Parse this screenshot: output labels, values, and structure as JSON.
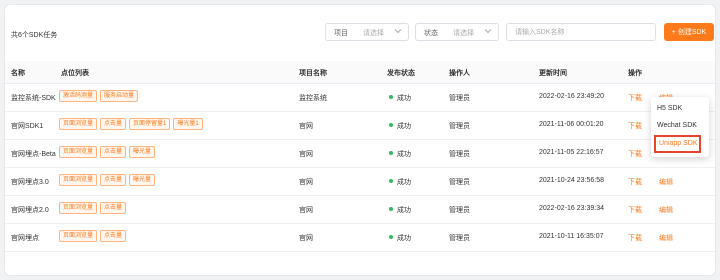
{
  "toolbar": {
    "summary": "共6个SDK任务",
    "project_label": "项目",
    "project_placeholder": "请选择",
    "status_label": "状态",
    "status_placeholder": "请选择",
    "search_placeholder": "请输入SDK名称",
    "create_label": "+ 创建SDK"
  },
  "table": {
    "headers": {
      "name": "名称",
      "points": "点位列表",
      "project": "项目名称",
      "status": "发布状态",
      "operator": "操作人",
      "updated": "更新时间",
      "actions": "操作"
    },
    "rows": [
      {
        "name": "监控系统-SDK",
        "points": [
          "激活码测量",
          "服务启动量"
        ],
        "project": "监控系统",
        "status": "成功",
        "operator": "管理员",
        "updated": "2022-02-16 23:49:20",
        "download": "下载",
        "edit": "编辑"
      },
      {
        "name": "官网SDK1",
        "points": [
          "页面浏览量",
          "点击量",
          "页面停留量1",
          "曝光量1"
        ],
        "project": "官网",
        "status": "成功",
        "operator": "管理员",
        "updated": "2021-11-06 00:01:20",
        "download": "下载",
        "edit": "编辑"
      },
      {
        "name": "官网埋点-Beta",
        "points": [
          "页面浏览量",
          "点击量",
          "曝光量"
        ],
        "project": "官网",
        "status": "成功",
        "operator": "管理员",
        "updated": "2021-11-05 22:16:57",
        "download": "下载",
        "edit": "编辑"
      },
      {
        "name": "官网埋点3.0",
        "points": [
          "页面浏览量",
          "点击量",
          "曝光量"
        ],
        "project": "官网",
        "status": "成功",
        "operator": "管理员",
        "updated": "2021-10-24 23:56:58",
        "download": "下载",
        "edit": "编辑"
      },
      {
        "name": "官网埋点2.0",
        "points": [
          "页面浏览量",
          "点击量"
        ],
        "project": "官网",
        "status": "成功",
        "operator": "管理员",
        "updated": "2022-02-16 23:39:34",
        "download": "下载",
        "edit": "编辑"
      },
      {
        "name": "官网埋点",
        "points": [
          "页面浏览量",
          "点击量"
        ],
        "project": "官网",
        "status": "成功",
        "operator": "管理员",
        "updated": "2021-10-11 16:35:07",
        "download": "下载",
        "edit": "编辑"
      }
    ]
  },
  "download_menu": {
    "items": [
      "H5 SDK",
      "Wechat SDK",
      "Uniapp SDK"
    ],
    "highlighted": "Uniapp SDK"
  },
  "colors": {
    "accent": "#ff7a1a",
    "success": "#2fc25b",
    "highlight_border": "#e8442a"
  }
}
